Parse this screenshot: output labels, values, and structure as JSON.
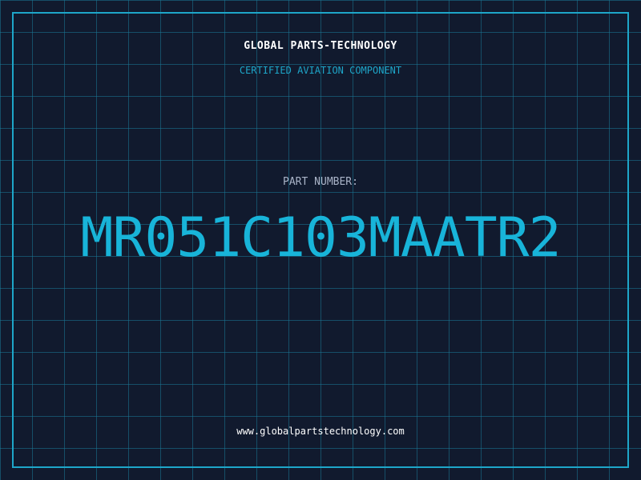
{
  "card": {
    "company_name": "GLOBAL PARTS-TECHNOLOGY",
    "tagline": "CERTIFIED AVIATION COMPONENT",
    "part_label": "PART NUMBER:",
    "part_number": "MR051C103MAATR2",
    "website": "www.globalpartstechnology.com"
  },
  "colors": {
    "background": "#111a2e",
    "grid": "#1a7896",
    "accent": "#1ea6c9",
    "text_primary": "#ffffff",
    "text_muted": "#aab4c8"
  }
}
